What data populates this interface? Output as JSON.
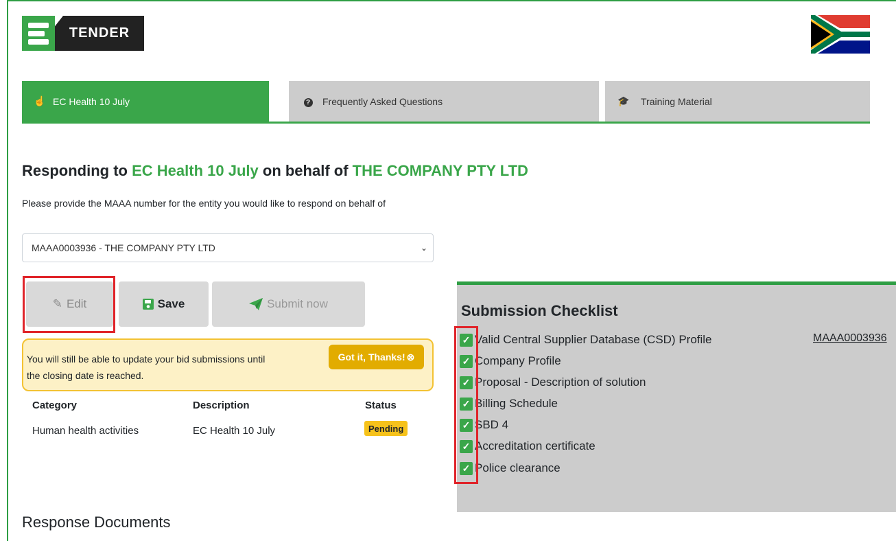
{
  "brand": {
    "logo_text": "TENDER"
  },
  "tabs": [
    {
      "label": "EC Health 10 July",
      "icon": "hand-pointer-icon"
    },
    {
      "label": "Frequently Asked Questions",
      "icon": "question-circle-icon"
    },
    {
      "label": "Training Material",
      "icon": "graduation-cap-icon"
    }
  ],
  "heading": {
    "prefix": "Responding to",
    "tender": "EC Health 10 July",
    "middle": "on behalf of",
    "company": "THE COMPANY PTY LTD"
  },
  "instruction": "Please provide the MAAA number for the entity you would like to respond on behalf of",
  "entity_select": {
    "value": "MAAA0003936 - THE COMPANY PTY LTD"
  },
  "actions": {
    "edit": "Edit",
    "save": "Save",
    "submit": "Submit now"
  },
  "alert": {
    "text": "You will still be able to update your bid submissions until the closing date is reached.",
    "button": "Got it, Thanks!"
  },
  "table": {
    "headers": [
      "Category",
      "Description",
      "Status"
    ],
    "rows": [
      {
        "category": "Human health activities",
        "description": "EC Health 10 July",
        "status": "Pending"
      }
    ]
  },
  "response_documents_title": "Response Documents",
  "checklist": {
    "title": "Submission Checklist",
    "items": [
      "Valid Central Supplier Database (CSD) Profile",
      "Company Profile",
      "Proposal - Description of solution",
      "Billing Schedule",
      "SBD 4",
      "Accreditation certificate",
      "Police clearance"
    ],
    "csd_link": "MAAA0003936"
  },
  "colors": {
    "brand_green": "#3aa64a",
    "badge_yellow": "#f6c21b",
    "highlight_red": "#e0242a"
  }
}
